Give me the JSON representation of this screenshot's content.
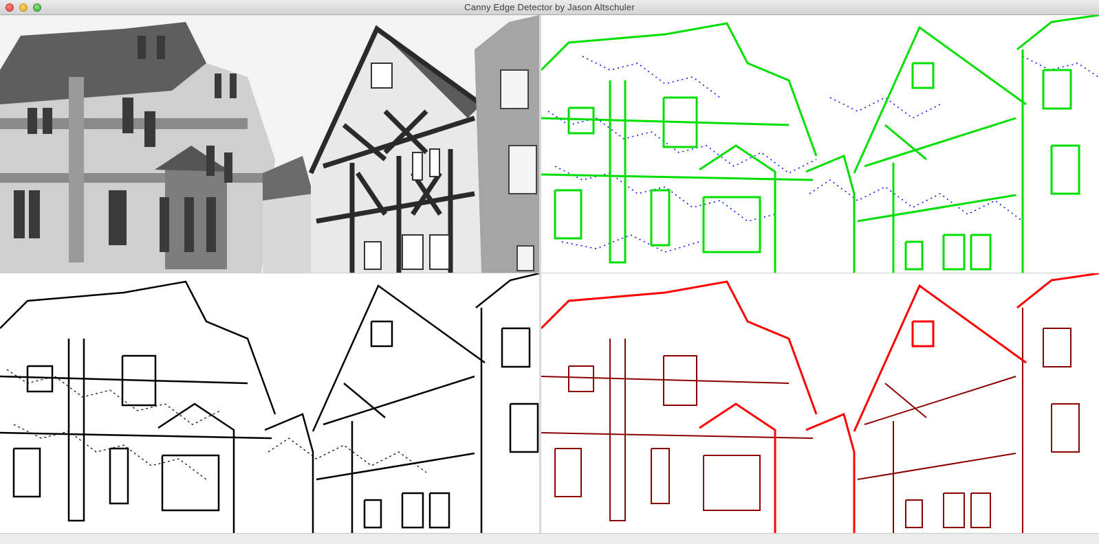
{
  "window": {
    "title": "Canny Edge Detector by Jason Altschuler"
  },
  "panels": [
    {
      "id": "grayscale-input",
      "stroke": "#1a1a1a"
    },
    {
      "id": "edges-green-blue",
      "strong_color": "#00e000",
      "weak_color": "#0000ff"
    },
    {
      "id": "edges-black",
      "stroke": "#000000"
    },
    {
      "id": "edges-red",
      "strong_color": "#ff0000",
      "weak_color": "#8b0000"
    }
  ],
  "colors": {
    "titlebar": "#dcdcdc",
    "close": "#ff5f57",
    "minimize": "#ffbd2e",
    "maximize": "#28c940"
  }
}
